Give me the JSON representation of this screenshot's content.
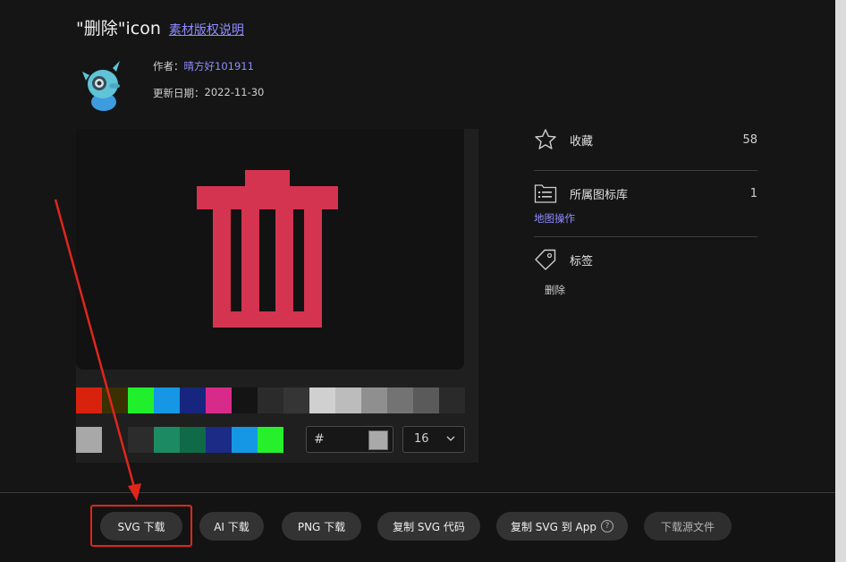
{
  "header": {
    "title": "\"删除\"icon",
    "copyright_link": "素材版权说明"
  },
  "meta": {
    "author_label": "作者：",
    "author_name": "晴方好101911",
    "date_label": "更新日期：",
    "date_value": "2022-11-30"
  },
  "preview": {
    "icon_name": "trash-icon",
    "icon_color": "#d4344f",
    "palette_row1": [
      "#d9220e",
      "#3a3000",
      "#20f02c",
      "#1597e5",
      "#16267e",
      "#d82a8a",
      "#141414",
      "#2b2b2b",
      "#353535",
      "#d0d0d0",
      "#bcbcbc",
      "#8f8f8f",
      "#737373",
      "#5a5a5a",
      "#2a2a2a"
    ],
    "palette_row2": [
      "#a8a8a8",
      "#1f1f1f",
      "#2c2c2c",
      "#1c8a62",
      "#0f6a47",
      "#1c2b86",
      "#1597e5",
      "#26f02c"
    ],
    "hex_prefix": "#",
    "hex_swatch_color": "#a9a9a9",
    "size_value": "16"
  },
  "side": {
    "favorite_label": "收藏",
    "favorite_count": "58",
    "library_label": "所属图标库",
    "library_count": "1",
    "library_name": "地图操作",
    "tags_label": "标签",
    "tag": "删除"
  },
  "footer": {
    "svg_download": "SVG 下载",
    "ai_download": "AI 下载",
    "png_download": "PNG 下载",
    "copy_svg_code": "复制 SVG 代码",
    "copy_svg_to_app": "复制 SVG 到 App",
    "download_source": "下载源文件",
    "help_glyph": "?"
  },
  "colors": {
    "accent_link": "#8f8cff",
    "annotation_red": "#e0261b"
  }
}
